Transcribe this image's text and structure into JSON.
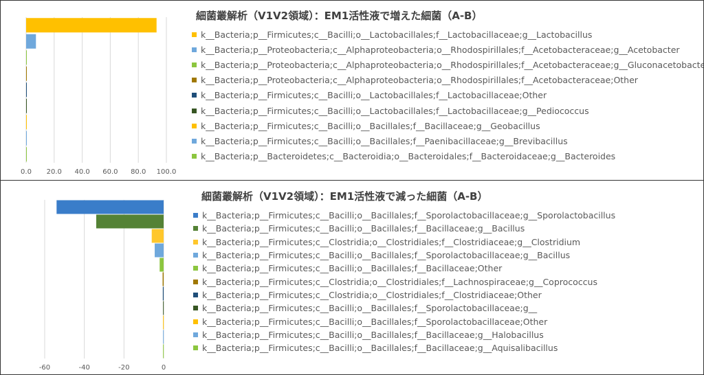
{
  "colors": {
    "yellow": "#FFC000",
    "lightblue": "#6FA8DC",
    "lightgreen": "#8CC63F",
    "brown": "#A07800",
    "darkblue": "#1F4E79",
    "darkgreen": "#375623",
    "blue": "#3A7DC9",
    "green": "#548235",
    "gold": "#FFC72C"
  },
  "chart_data": [
    {
      "type": "bar",
      "orientation": "horizontal",
      "title": "細菌叢解析（V1V2領域）：EM1活性液で増えた細菌（A-B）",
      "xlim": [
        0,
        100
      ],
      "xticks": [
        "0.0",
        "20.0",
        "40.0",
        "60.0",
        "80.0",
        "100.0"
      ],
      "xtick_values": [
        0,
        20,
        40,
        60,
        80,
        100
      ],
      "legend_position": "right",
      "series": [
        {
          "name": "k__Bacteria;p__Firmicutes;c__Bacilli;o__Lactobacillales;f__Lactobacillaceae;g__Lactobacillus",
          "value": 93,
          "color": "#FFC000"
        },
        {
          "name": "k__Bacteria;p__Proteobacteria;c__Alphaproteobacteria;o__Rhodospirillales;f__Acetobacteraceae;g__Acetobacter",
          "value": 7,
          "color": "#6FA8DC"
        },
        {
          "name": "k__Bacteria;p__Proteobacteria;c__Alphaproteobacteria;o__Rhodospirillales;f__Acetobacteraceae;g__Gluconacetobacter",
          "value": 0.3,
          "color": "#8CC63F"
        },
        {
          "name": "k__Bacteria;p__Proteobacteria;c__Alphaproteobacteria;o__Rhodospirillales;f__Acetobacteraceae;Other",
          "value": 0.3,
          "color": "#A07800"
        },
        {
          "name": "k__Bacteria;p__Firmicutes;c__Bacilli;o__Lactobacillales;f__Lactobacillaceae;Other",
          "value": 0.3,
          "color": "#1F4E79"
        },
        {
          "name": "k__Bacteria;p__Firmicutes;c__Bacilli;o__Lactobacillales;f__Lactobacillaceae;g__Pediococcus",
          "value": 0.3,
          "color": "#375623"
        },
        {
          "name": "k__Bacteria;p__Firmicutes;c__Bacilli;o__Bacillales;f__Bacillaceae;g__Geobacillus",
          "value": 0.3,
          "color": "#FFC000"
        },
        {
          "name": "k__Bacteria;p__Firmicutes;c__Bacilli;o__Bacillales;f__Paenibacillaceae;g__Brevibacillus",
          "value": 0.3,
          "color": "#6FA8DC"
        },
        {
          "name": "k__Bacteria;p__Bacteroidetes;c__Bacteroidia;o__Bacteroidales;f__Bacteroidaceae;g__Bacteroides",
          "value": 0.3,
          "color": "#8CC63F"
        }
      ]
    },
    {
      "type": "bar",
      "orientation": "horizontal",
      "title": "細菌叢解析（V1V2領域）：EM1活性液で減った細菌（A-B）",
      "xlim": [
        -60,
        0
      ],
      "xticks": [
        "-60",
        "-40",
        "-20",
        "0"
      ],
      "xtick_values": [
        -60,
        -40,
        -20,
        0
      ],
      "legend_position": "right",
      "series": [
        {
          "name": "k__Bacteria;p__Firmicutes;c__Bacilli;o__Bacillales;f__Sporolactobacillaceae;g__Sporolactobacillus",
          "value": -54,
          "color": "#3A7DC9"
        },
        {
          "name": "k__Bacteria;p__Firmicutes;c__Bacilli;o__Bacillales;f__Bacillaceae;g__Bacillus",
          "value": -34,
          "color": "#548235"
        },
        {
          "name": "k__Bacteria;p__Firmicutes;c__Clostridia;o__Clostridiales;f__Clostridiaceae;g__Clostridium",
          "value": -6,
          "color": "#FFC72C"
        },
        {
          "name": "k__Bacteria;p__Firmicutes;c__Bacilli;o__Bacillales;f__Sporolactobacillaceae;g__Bacillus",
          "value": -4.5,
          "color": "#6FA8DC"
        },
        {
          "name": "k__Bacteria;p__Firmicutes;c__Bacilli;o__Bacillales;f__Bacillaceae;Other",
          "value": -2,
          "color": "#8CC63F"
        },
        {
          "name": "k__Bacteria;p__Firmicutes;c__Clostridia;o__Clostridiales;f__Lachnospiraceae;g__Coprococcus",
          "value": -0.5,
          "color": "#A07800"
        },
        {
          "name": "k__Bacteria;p__Firmicutes;c__Clostridia;o__Clostridiales;f__Clostridiaceae;Other",
          "value": -0.4,
          "color": "#1F4E79"
        },
        {
          "name": "k__Bacteria;p__Firmicutes;c__Bacilli;o__Bacillales;f__Sporolactobacillaceae;g__",
          "value": -0.3,
          "color": "#375623"
        },
        {
          "name": "k__Bacteria;p__Firmicutes;c__Bacilli;o__Bacillales;f__Sporolactobacillaceae;Other",
          "value": -0.3,
          "color": "#FFC000"
        },
        {
          "name": "k__Bacteria;p__Firmicutes;c__Bacilli;o__Bacillales;f__Bacillaceae;g__Halobacillus",
          "value": -0.3,
          "color": "#6FA8DC"
        },
        {
          "name": "k__Bacteria;p__Firmicutes;c__Bacilli;o__Bacillales;f__Bacillaceae;g__Aquisalibacillus",
          "value": -0.3,
          "color": "#8CC63F"
        }
      ]
    }
  ]
}
